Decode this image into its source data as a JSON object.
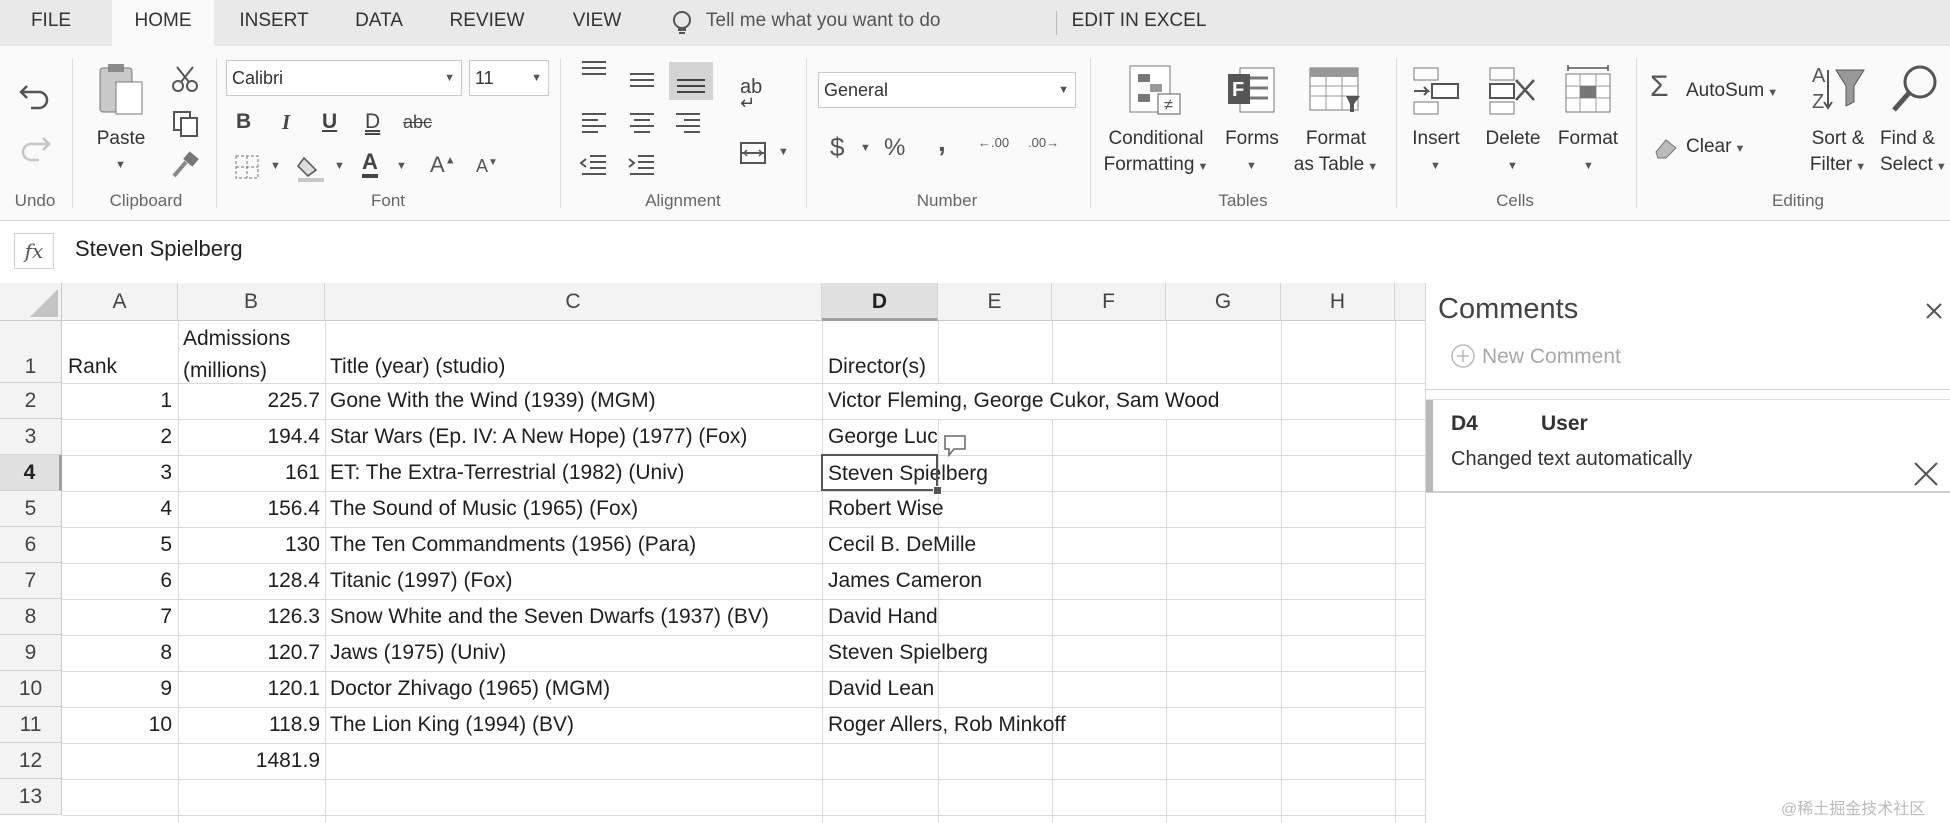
{
  "tabs": [
    "FILE",
    "HOME",
    "INSERT",
    "DATA",
    "REVIEW",
    "VIEW"
  ],
  "tell_me": "Tell me what you want to do",
  "edit_in_excel": "EDIT IN EXCEL",
  "ribbon": {
    "undo_label": "Undo",
    "clipboard": {
      "paste": "Paste",
      "group": "Clipboard"
    },
    "font": {
      "name": "Calibri",
      "size": "11",
      "group": "Font",
      "bold": "B",
      "italic": "I",
      "underline": "U",
      "double_underline": "D",
      "strike": "abc",
      "grow": "A",
      "shrink": "A",
      "font_color": "A"
    },
    "alignment": {
      "group": "Alignment",
      "wrap": "ab"
    },
    "number": {
      "format": "General",
      "group": "Number",
      "currency": "$",
      "percent": "%",
      "comma": ",",
      "inc_decimal": ".00",
      "dec_decimal": ".00"
    },
    "tables": {
      "group": "Tables",
      "conditional": [
        "Conditional",
        "Formatting"
      ],
      "forms": "Forms",
      "format_table": [
        "Format",
        "as Table"
      ]
    },
    "cells": {
      "group": "Cells",
      "insert": "Insert",
      "delete": "Delete",
      "format": "Format"
    },
    "editing": {
      "group": "Editing",
      "autosum": "AutoSum",
      "clear": "Clear",
      "sort": [
        "Sort &",
        "Filter"
      ],
      "find": [
        "Find &",
        "Select"
      ]
    }
  },
  "formula_bar": {
    "fx": "fx",
    "value": "Steven Spielberg"
  },
  "sheet": {
    "columns": [
      "A",
      "B",
      "C",
      "D",
      "E",
      "F",
      "G",
      "H"
    ],
    "rows": [
      "1",
      "2",
      "3",
      "4",
      "5",
      "6",
      "7",
      "8",
      "9",
      "10",
      "11",
      "12",
      "13"
    ],
    "header_row": {
      "rank": "Rank",
      "admissions_1": "Admissions",
      "admissions_2": "(millions)",
      "title": "Title (year) (studio)",
      "director": "Director(s)"
    },
    "data": [
      {
        "rank": "1",
        "admissions": "225.7",
        "title": "Gone With the Wind (1939) (MGM)",
        "director": "Victor Fleming, George Cukor, Sam Wood"
      },
      {
        "rank": "2",
        "admissions": "194.4",
        "title": "Star Wars (Ep. IV: A New Hope) (1977) (Fox)",
        "director": "George Luc"
      },
      {
        "rank": "3",
        "admissions": "161",
        "title": "ET: The Extra-Terrestrial (1982) (Univ)",
        "director": "Steven Spielberg"
      },
      {
        "rank": "4",
        "admissions": "156.4",
        "title": "The Sound of Music (1965) (Fox)",
        "director": "Robert Wise"
      },
      {
        "rank": "5",
        "admissions": "130",
        "title": "The Ten Commandments (1956) (Para)",
        "director": "Cecil B. DeMille"
      },
      {
        "rank": "6",
        "admissions": "128.4",
        "title": "Titanic (1997) (Fox)",
        "director": "James Cameron"
      },
      {
        "rank": "7",
        "admissions": "126.3",
        "title": "Snow White and the Seven Dwarfs (1937) (BV)",
        "director": "David Hand"
      },
      {
        "rank": "8",
        "admissions": "120.7",
        "title": "Jaws (1975) (Univ)",
        "director": "Steven Spielberg"
      },
      {
        "rank": "9",
        "admissions": "120.1",
        "title": "Doctor Zhivago (1965) (MGM)",
        "director": "David Lean"
      },
      {
        "rank": "10",
        "admissions": "118.9",
        "title": "The Lion King (1994) (BV)",
        "director": "Roger Allers, Rob Minkoff"
      }
    ],
    "total": "1481.9",
    "selected_cell": "D4"
  },
  "comments": {
    "title": "Comments",
    "new_comment": "New Comment",
    "item": {
      "cell": "D4",
      "user": "User",
      "text": "Changed text automatically"
    }
  },
  "watermark": "@稀土掘金技术社区",
  "colors": {
    "accent": "#217346",
    "tab_bar": "#e9e9e9",
    "ribbon": "#fafafa"
  }
}
